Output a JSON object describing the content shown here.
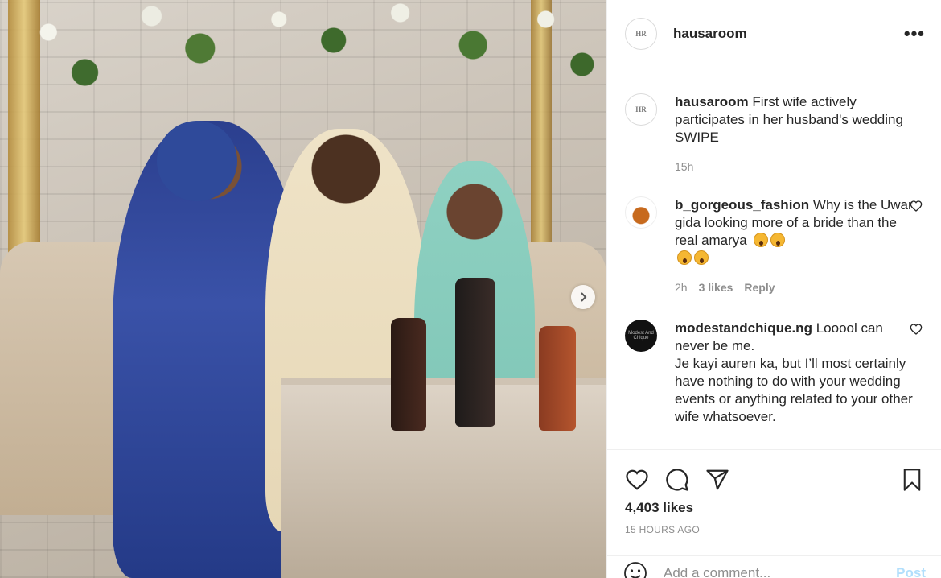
{
  "post": {
    "username": "hausaroom",
    "avatar_text": "HR",
    "more_label": "•••",
    "caption": "First wife actively participates in her husband's wedding SWIPE",
    "caption_time": "15h",
    "next_icon": "chevron-right-icon"
  },
  "comments": [
    {
      "username": "b_gorgeous_fashion",
      "text": "Why is the Uwar gida looking more of a bride than the real amarya",
      "time": "2h",
      "likes": "3 likes",
      "reply": "Reply"
    },
    {
      "username": "modestandchique.ng",
      "avatar_text": "Modest And Chique",
      "text_line1": "Looool can never be me.",
      "text_line2": "Je kayi auren ka, but I’ll most certainly have nothing to do with your wedding events or anything related to your other wife whatsoever."
    }
  ],
  "actions": {
    "likes": "4,403 likes",
    "time_ago": "15 HOURS AGO"
  },
  "add_comment": {
    "placeholder": "Add a comment...",
    "post_label": "Post"
  },
  "colors": {
    "post_button_disabled": "#b2dffc",
    "secondary_text": "#8e8e8e"
  }
}
